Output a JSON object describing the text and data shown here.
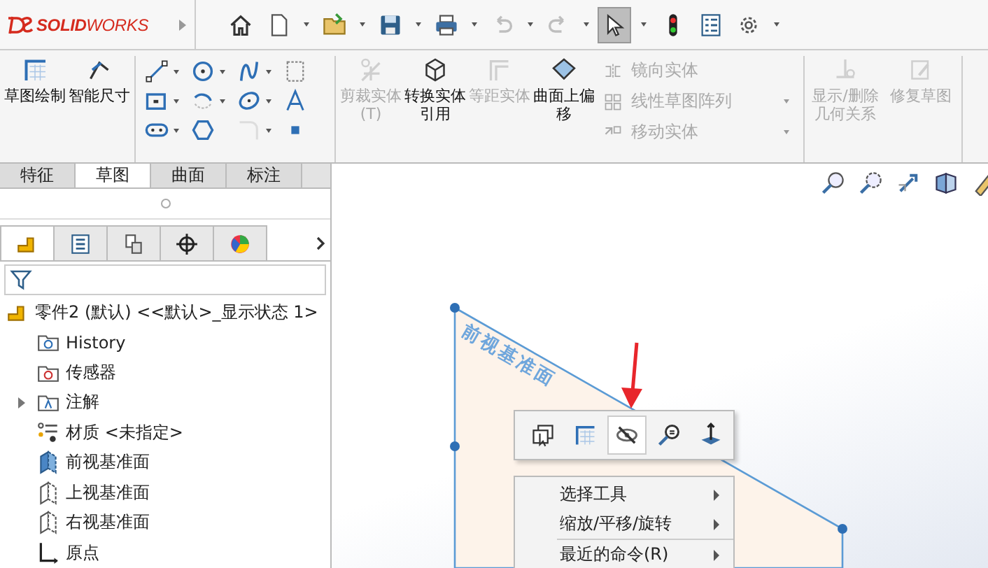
{
  "app": {
    "logo": "**SOLID**WORKS"
  },
  "quick_access": [
    {
      "kind": "home",
      "menu": false,
      "disabled": false,
      "selected": false
    },
    {
      "kind": "new",
      "menu": true,
      "disabled": false,
      "selected": false
    },
    {
      "kind": "open",
      "menu": true,
      "disabled": false,
      "selected": false
    },
    {
      "kind": "save",
      "menu": true,
      "disabled": false,
      "selected": false
    },
    {
      "kind": "print",
      "menu": true,
      "disabled": false,
      "selected": false
    },
    {
      "kind": "undo",
      "menu": true,
      "disabled": true,
      "selected": false
    },
    {
      "kind": "redo",
      "menu": true,
      "disabled": true,
      "selected": false
    },
    {
      "kind": "select",
      "menu": true,
      "disabled": false,
      "selected": true
    },
    {
      "kind": "rebuild",
      "menu": false,
      "disabled": false,
      "selected": false
    },
    {
      "kind": "file-properties",
      "menu": false,
      "disabled": false,
      "selected": false
    },
    {
      "kind": "options",
      "menu": true,
      "disabled": false,
      "selected": false
    }
  ],
  "ribbon": {
    "large_tools": [
      {
        "label": "草图绘制",
        "kind": "sketch",
        "disabled": false
      },
      {
        "label": "智能尺寸",
        "kind": "dimension",
        "disabled": false
      }
    ],
    "sketch_tools": [
      {
        "kind": "line",
        "menu": true,
        "disabled": false
      },
      {
        "kind": "circle",
        "menu": true,
        "disabled": false
      },
      {
        "kind": "spline",
        "menu": true,
        "disabled": false
      },
      {
        "kind": "construction",
        "menu": false,
        "disabled": false
      },
      {
        "kind": "rectangle",
        "menu": true,
        "disabled": false
      },
      {
        "kind": "arc",
        "menu": true,
        "disabled": false
      },
      {
        "kind": "ellipse",
        "menu": true,
        "disabled": false
      },
      {
        "kind": "text",
        "menu": false,
        "disabled": false
      },
      {
        "kind": "slot",
        "menu": true,
        "disabled": false
      },
      {
        "kind": "polygon",
        "menu": false,
        "disabled": false
      },
      {
        "kind": "fillet",
        "menu": true,
        "disabled": true
      },
      {
        "kind": "point",
        "menu": false,
        "disabled": false
      }
    ],
    "edit_tools": [
      {
        "label": "剪裁实体(T)",
        "kind": "trim",
        "disabled": true
      },
      {
        "label": "转换实体引用",
        "kind": "convert",
        "disabled": false
      },
      {
        "label": "等距实体",
        "kind": "offset",
        "disabled": true
      },
      {
        "label": "曲面上偏移",
        "kind": "surface-offset",
        "disabled": false
      }
    ],
    "list_tools": [
      {
        "label": "镜向实体",
        "kind": "mirror",
        "disabled": true,
        "menu": false
      },
      {
        "label": "线性草图阵列",
        "kind": "pattern",
        "disabled": true,
        "menu": true
      },
      {
        "label": "移动实体",
        "kind": "move",
        "disabled": true,
        "menu": true
      }
    ],
    "relation_tools": [
      {
        "label": "显示/删除几何关系",
        "kind": "relations",
        "disabled": true
      },
      {
        "label": "修复草图",
        "kind": "repair",
        "disabled": true
      }
    ]
  },
  "command_tabs": [
    {
      "label": "特征",
      "selected": false
    },
    {
      "label": "草图",
      "selected": true
    },
    {
      "label": "曲面",
      "selected": false
    },
    {
      "label": "标注",
      "selected": false
    }
  ],
  "manager_tabs": [
    {
      "kind": "feature",
      "selected": true
    },
    {
      "kind": "property",
      "selected": false
    },
    {
      "kind": "config",
      "selected": false
    },
    {
      "kind": "dimxpert",
      "selected": false
    },
    {
      "kind": "display",
      "selected": false
    }
  ],
  "feature_tree": {
    "label": "零件2 (默认) <<默认>_显示状态 1>",
    "children": [
      {
        "label": "History",
        "kind": "history"
      },
      {
        "label": "传感器",
        "kind": "sensors"
      },
      {
        "label": "注解",
        "kind": "annotations",
        "expanded": false
      },
      {
        "label": "材质 <未指定>",
        "kind": "material"
      },
      {
        "label": "前视基准面",
        "kind": "front-plane"
      },
      {
        "label": "上视基准面",
        "kind": "plane"
      },
      {
        "label": "右视基准面",
        "kind": "plane"
      },
      {
        "label": "原点",
        "kind": "origin"
      }
    ]
  },
  "view_toolbar": [
    {
      "kind": "zoom-fit"
    },
    {
      "kind": "zoom-area"
    },
    {
      "kind": "previous-view"
    },
    {
      "kind": "section-view"
    },
    {
      "kind": "annotation-view"
    }
  ],
  "canvas": {
    "plane_label": "前视基准面",
    "context_toolbar": [
      {
        "kind": "select-other",
        "selected": false
      },
      {
        "kind": "sketch",
        "selected": false
      },
      {
        "kind": "hide",
        "selected": true
      },
      {
        "kind": "zoom-selection",
        "selected": false
      },
      {
        "kind": "normal-to",
        "selected": false
      }
    ],
    "context_menu": [
      {
        "label": "选择工具",
        "submenu": true,
        "separator_before": false
      },
      {
        "label": "缩放/平移/旋转",
        "submenu": true,
        "separator_before": false
      },
      {
        "label": "最近的命令(R)",
        "submenu": true,
        "separator_before": true
      }
    ]
  }
}
